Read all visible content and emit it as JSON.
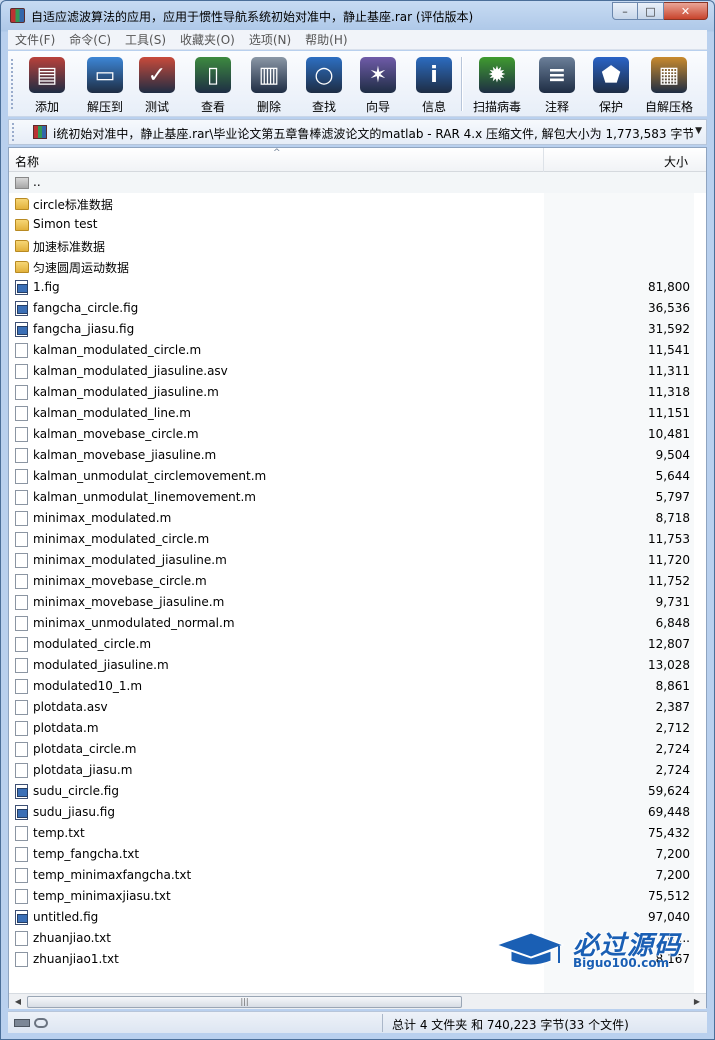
{
  "window": {
    "title": "自适应滤波算法的应用，应用于惯性导航系统初始对准中，静止基座.rar (评估版本)",
    "controls": [
      "–",
      "□",
      "✕"
    ]
  },
  "menu": [
    "文件(F)",
    "命令(C)",
    "工具(S)",
    "收藏夹(O)",
    "选项(N)",
    "帮助(H)"
  ],
  "toolbar": [
    {
      "label": "添加",
      "icon": "archive-add-icon",
      "color": "#b9413a"
    },
    {
      "label": "解压到",
      "icon": "folder-extract-icon",
      "color": "#3d86d6"
    },
    {
      "label": "测试",
      "icon": "clipboard-check-icon",
      "color": "#c94a3a"
    },
    {
      "label": "查看",
      "icon": "book-view-icon",
      "color": "#3d8a3f"
    },
    {
      "label": "删除",
      "icon": "trash-icon",
      "color": "#8a97a6"
    },
    {
      "label": "查找",
      "icon": "magnifier-icon",
      "color": "#2d6fc2"
    },
    {
      "label": "向导",
      "icon": "wand-icon",
      "color": "#6f5ba8"
    },
    {
      "label": "信息",
      "icon": "info-icon",
      "color": "#2c6cc0"
    },
    {
      "label": "扫描病毒",
      "icon": "virus-scan-icon",
      "color": "#3f9b2f"
    },
    {
      "label": "注释",
      "icon": "comment-icon",
      "color": "#6b7f99"
    },
    {
      "label": "保护",
      "icon": "shield-icon",
      "color": "#2a63c6"
    },
    {
      "label": "自解压格",
      "icon": "sfx-box-icon",
      "color": "#c98a2d"
    }
  ],
  "address": {
    "text": "i统初始对准中，静止基座.rar\\毕业论文第五章鲁棒滤波论文的matlab - RAR 4.x 压缩文件, 解包大小为 1,773,583 字节",
    "dropdown": "▼"
  },
  "columns": {
    "name": "名称",
    "size": "大小",
    "sort_indicator": "^"
  },
  "files": [
    {
      "name": "..",
      "size": "",
      "type": "updir"
    },
    {
      "name": "circle标准数据",
      "size": "",
      "type": "folder"
    },
    {
      "name": "Simon test",
      "size": "",
      "type": "folder"
    },
    {
      "name": "加速标准数据",
      "size": "",
      "type": "folder"
    },
    {
      "name": "匀速圆周运动数据",
      "size": "",
      "type": "folder"
    },
    {
      "name": "1.fig",
      "size": "81,800",
      "type": "fig"
    },
    {
      "name": "fangcha_circle.fig",
      "size": "36,536",
      "type": "fig"
    },
    {
      "name": "fangcha_jiasu.fig",
      "size": "31,592",
      "type": "fig"
    },
    {
      "name": "kalman_modulated_circle.m",
      "size": "11,541",
      "type": "doc"
    },
    {
      "name": "kalman_modulated_jiasuline.asv",
      "size": "11,311",
      "type": "doc"
    },
    {
      "name": "kalman_modulated_jiasuline.m",
      "size": "11,318",
      "type": "doc"
    },
    {
      "name": "kalman_modulated_line.m",
      "size": "11,151",
      "type": "doc"
    },
    {
      "name": "kalman_movebase_circle.m",
      "size": "10,481",
      "type": "doc"
    },
    {
      "name": "kalman_movebase_jiasuline.m",
      "size": "9,504",
      "type": "doc"
    },
    {
      "name": "kalman_unmodulat_circlemovement.m",
      "size": "5,644",
      "type": "doc"
    },
    {
      "name": "kalman_unmodulat_linemovement.m",
      "size": "5,797",
      "type": "doc"
    },
    {
      "name": "minimax_modulated.m",
      "size": "8,718",
      "type": "doc"
    },
    {
      "name": "minimax_modulated_circle.m",
      "size": "11,753",
      "type": "doc"
    },
    {
      "name": "minimax_modulated_jiasuline.m",
      "size": "11,720",
      "type": "doc"
    },
    {
      "name": "minimax_movebase_circle.m",
      "size": "11,752",
      "type": "doc"
    },
    {
      "name": "minimax_movebase_jiasuline.m",
      "size": "9,731",
      "type": "doc"
    },
    {
      "name": "minimax_unmodulated_normal.m",
      "size": "6,848",
      "type": "doc"
    },
    {
      "name": "modulated_circle.m",
      "size": "12,807",
      "type": "doc"
    },
    {
      "name": "modulated_jiasuline.m",
      "size": "13,028",
      "type": "doc"
    },
    {
      "name": "modulated10_1.m",
      "size": "8,861",
      "type": "doc"
    },
    {
      "name": "plotdata.asv",
      "size": "2,387",
      "type": "doc"
    },
    {
      "name": "plotdata.m",
      "size": "2,712",
      "type": "doc"
    },
    {
      "name": "plotdata_circle.m",
      "size": "2,724",
      "type": "doc"
    },
    {
      "name": "plotdata_jiasu.m",
      "size": "2,724",
      "type": "doc"
    },
    {
      "name": "sudu_circle.fig",
      "size": "59,624",
      "type": "fig"
    },
    {
      "name": "sudu_jiasu.fig",
      "size": "69,448",
      "type": "fig"
    },
    {
      "name": "temp.txt",
      "size": "75,432",
      "type": "doc"
    },
    {
      "name": "temp_fangcha.txt",
      "size": "7,200",
      "type": "doc"
    },
    {
      "name": "temp_minimaxfangcha.txt",
      "size": "7,200",
      "type": "doc"
    },
    {
      "name": "temp_minimaxjiasu.txt",
      "size": "75,512",
      "type": "doc"
    },
    {
      "name": "untitled.fig",
      "size": "97,040",
      "type": "fig"
    },
    {
      "name": "zhuanjiao.txt",
      "size": "8,...",
      "type": "doc"
    },
    {
      "name": "zhuanjiao1.txt",
      "size": "8,167",
      "type": "doc"
    }
  ],
  "scrollbar": {
    "left": "◀",
    "right": "▶",
    "thumb": "|||"
  },
  "status": {
    "text": "总计 4 文件夹 和 740,223 字节(33 个文件)"
  },
  "watermark": {
    "cn": "必过源码",
    "en": "Biguo100.com"
  }
}
